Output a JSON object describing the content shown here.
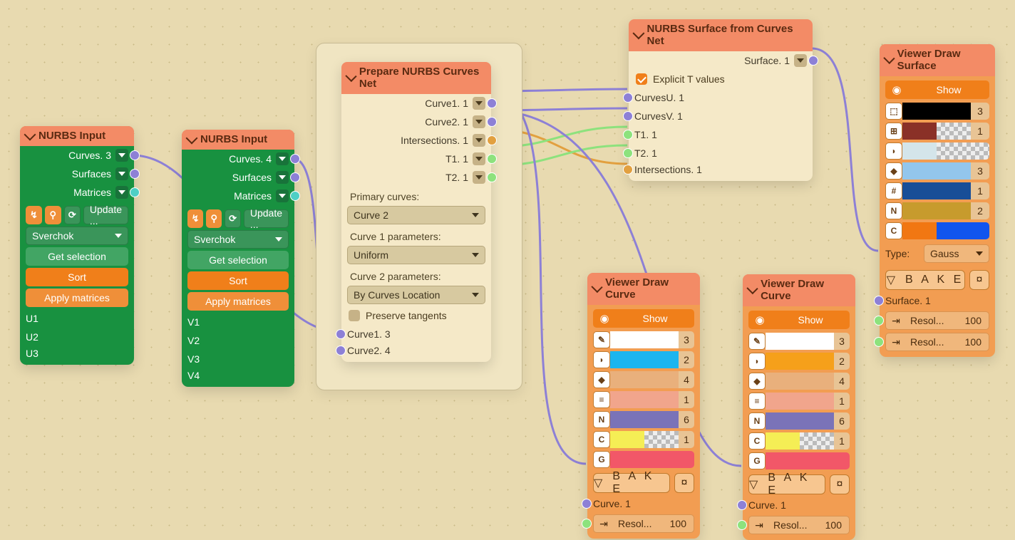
{
  "nurbsA": {
    "title": "NURBS Input",
    "outs": {
      "curves": "Curves. 3",
      "surfaces": "Surfaces",
      "matrices": "Matrices"
    },
    "update": "Update ...",
    "library": "Sverchok",
    "btns": {
      "get": "Get selection",
      "sort": "Sort",
      "apply": "Apply matrices"
    },
    "params": [
      "U1",
      "U2",
      "U3"
    ]
  },
  "nurbsB": {
    "title": "NURBS Input",
    "outs": {
      "curves": "Curves. 4",
      "surfaces": "Surfaces",
      "matrices": "Matrices"
    },
    "update": "Update ...",
    "library": "Sverchok",
    "btns": {
      "get": "Get selection",
      "sort": "Sort",
      "apply": "Apply matrices"
    },
    "params": [
      "V1",
      "V2",
      "V3",
      "V4"
    ]
  },
  "prep": {
    "title": "Prepare NURBS Curves Net",
    "outs": {
      "c1": "Curve1. 1",
      "c2": "Curve2. 1",
      "ints": "Intersections. 1",
      "t1": "T1. 1",
      "t2": "T2. 1"
    },
    "lblPrimary": "Primary curves:",
    "primary": "Curve 2",
    "lblC1p": "Curve 1 parameters:",
    "c1p": "Uniform",
    "lblC2p": "Curve 2 parameters:",
    "c2p": "By Curves Location",
    "preserve": "Preserve tangents",
    "ins": {
      "c1": "Curve1. 3",
      "c2": "Curve2. 4"
    }
  },
  "surf": {
    "title": "NURBS Surface from Curves Net",
    "out": "Surface. 1",
    "explicit": "Explicit T values",
    "ins": {
      "cu": "CurvesU. 1",
      "cv": "CurvesV. 1",
      "t1": "T1. 1",
      "t2": "T2. 1",
      "ints": "Intersections. 1"
    }
  },
  "viewC": {
    "title": "Viewer Draw Curve",
    "show": "Show",
    "bake": "B A K E",
    "rows": [
      {
        "ic": "✎",
        "c1": "#ffffff",
        "c2": "",
        "n": "3"
      },
      {
        "ic": "◗",
        "c1": "#1cb5ef",
        "c2": "",
        "n": "2"
      },
      {
        "ic": "◆",
        "c1": "#e9b07c",
        "c2": "",
        "n": "4"
      },
      {
        "ic": "≡",
        "c1": "#f1a58c",
        "c2": "",
        "n": "1"
      },
      {
        "ic": "N",
        "c1": "#7a73b8",
        "c2": "",
        "n": "6"
      },
      {
        "ic": "C",
        "c1": "#f5ee55",
        "c2": "checker",
        "n": "1"
      },
      {
        "ic": "G",
        "c1": "#f25768",
        "c2": "span",
        "n": ""
      }
    ],
    "inCurve": "Curve. 1",
    "spin": {
      "lbl": "Resol...",
      "v": "100"
    }
  },
  "viewC2": {
    "title": "Viewer Draw Curve",
    "show": "Show",
    "bake": "B A K E",
    "rows": [
      {
        "ic": "✎",
        "c1": "#ffffff",
        "c2": "",
        "n": "3"
      },
      {
        "ic": "◗",
        "c1": "#f6a01a",
        "c2": "",
        "n": "2"
      },
      {
        "ic": "◆",
        "c1": "#e9b07c",
        "c2": "",
        "n": "4"
      },
      {
        "ic": "≡",
        "c1": "#f1a58c",
        "c2": "",
        "n": "1"
      },
      {
        "ic": "N",
        "c1": "#7a73b8",
        "c2": "",
        "n": "6"
      },
      {
        "ic": "C",
        "c1": "#f5ee55",
        "c2": "checker",
        "n": "1"
      },
      {
        "ic": "G",
        "c1": "#f25768",
        "c2": "span",
        "n": ""
      }
    ],
    "inCurve": "Curve. 1",
    "spin": {
      "lbl": "Resol...",
      "v": "100"
    }
  },
  "viewS": {
    "title": "Viewer Draw Surface",
    "show": "Show",
    "bake": "B A K E",
    "rows": [
      {
        "ic": "⬚",
        "c1": "#000000",
        "c2": "",
        "n": "3"
      },
      {
        "ic": "⊞",
        "c1": "#8a3027",
        "c2": "checker",
        "n": "1"
      },
      {
        "ic": "◗",
        "c1": "#d4e5ea",
        "c2": "checker",
        "n": ""
      },
      {
        "ic": "◆",
        "c1": "#93c6ec",
        "c2": "",
        "n": "3"
      },
      {
        "ic": "#",
        "c1": "#184e97",
        "c2": "",
        "n": "1"
      },
      {
        "ic": "N",
        "c1": "#c79b2d",
        "c2": "",
        "n": "2"
      },
      {
        "ic": "C",
        "c1": "#f17712",
        "c2": "#1155ee",
        "n": ""
      }
    ],
    "typeLbl": "Type:",
    "type": "Gauss",
    "inSurf": "Surface. 1",
    "spin1": {
      "lbl": "Resol...",
      "v": "100"
    },
    "spin2": {
      "lbl": "Resol...",
      "v": "100"
    }
  }
}
